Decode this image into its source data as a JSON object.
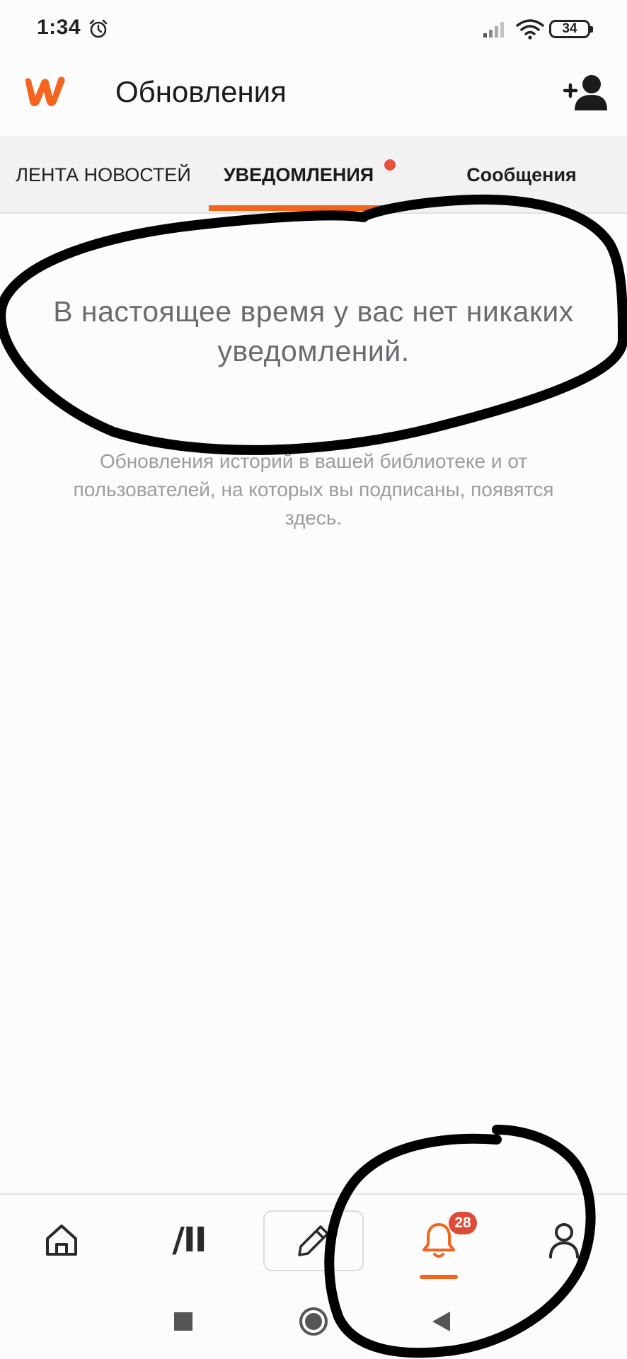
{
  "status_bar": {
    "time": "1:34",
    "battery": "34",
    "icons": [
      "alarm-icon",
      "signal-icon",
      "wifi-icon",
      "battery-icon"
    ]
  },
  "header": {
    "logo": "wattpad-logo",
    "title": "Обновления",
    "action_icon": "add-user-icon"
  },
  "tabs": [
    {
      "label": "ЛЕНТА НОВОСТЕЙ",
      "active": false
    },
    {
      "label": "УВЕДОМЛЕНИЯ",
      "active": true,
      "has_dot": true
    },
    {
      "label": "Сообщения",
      "active": false
    }
  ],
  "empty_state": {
    "title": "В настоящее время у вас нет никаких уведомлений.",
    "description": "Обновления историй в вашей библиотеке и от пользователей, на которых вы подписаны, появятся здесь."
  },
  "bottom_nav": {
    "items": [
      {
        "name": "home",
        "icon": "home-icon"
      },
      {
        "name": "library",
        "icon": "library-icon",
        "glyph": "/II"
      },
      {
        "name": "write",
        "icon": "pencil-icon"
      },
      {
        "name": "notifications",
        "icon": "bell-icon",
        "badge": "28",
        "active": true
      },
      {
        "name": "profile",
        "icon": "user-icon"
      }
    ]
  },
  "system_nav": {
    "buttons": [
      "recents-icon",
      "home-circle-icon",
      "back-icon"
    ]
  },
  "colors": {
    "accent": "#f4641e",
    "badge": "#de4a36",
    "tab_background": "#f3f2f3",
    "empty_title": "#6c6a6f",
    "empty_description": "#9d9ba0",
    "annotation": "#000000"
  }
}
